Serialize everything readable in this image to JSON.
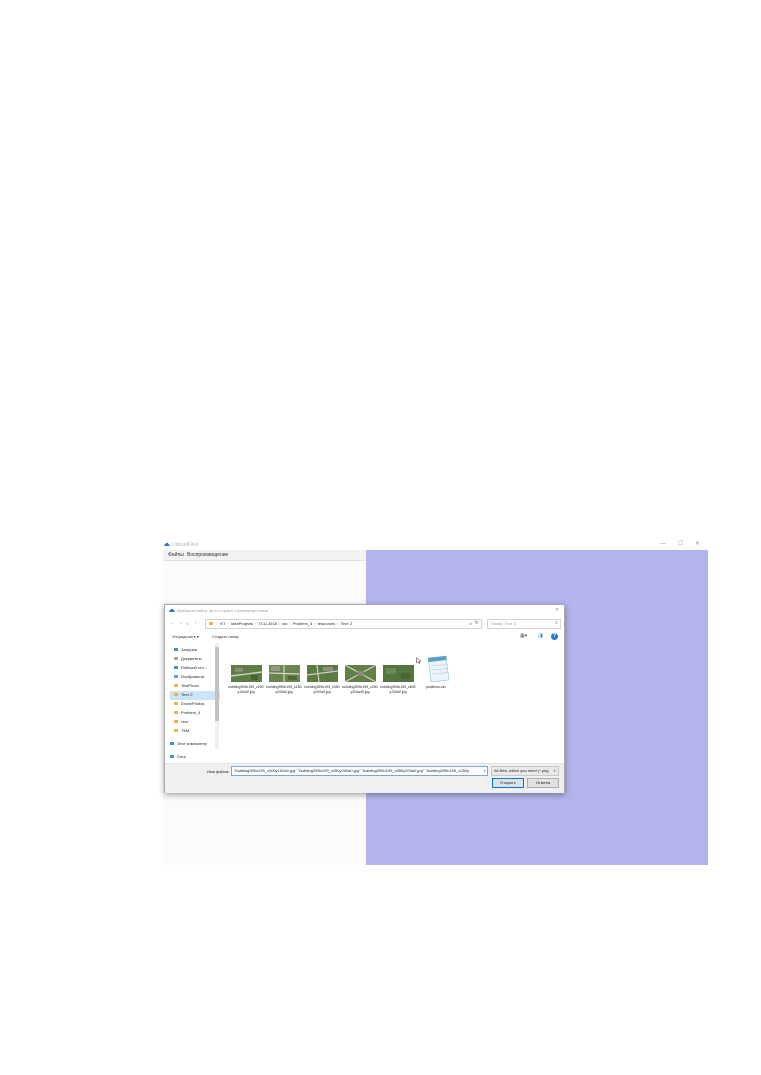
{
  "app": {
    "title": "UploadFiles",
    "menu": [
      "Файлы",
      "Воспроизведение"
    ],
    "window_controls": [
      "—",
      "☐",
      "✕"
    ],
    "colors": {
      "canvas": "#b3b4ec",
      "accent": "#0078d7"
    }
  },
  "dialog": {
    "title": "Выберите набор фото и файл с перемещениями",
    "close": "✕",
    "nav_buttons": [
      "←",
      "→",
      "∨",
      "↑"
    ],
    "breadcrumbs": [
      "KT",
      "IdeaProjects",
      "TCU-2018",
      "src",
      "Problem_3",
      "resources",
      "Тест 2"
    ],
    "search_placeholder": "Поиск: Тест 2",
    "toolbar": {
      "organize": "Упорядочить ▾",
      "new_folder": "Создать папку"
    },
    "nav_items": [
      {
        "label": "Загрузки",
        "icon": "download-icon",
        "pinned": true
      },
      {
        "label": "Документы",
        "icon": "documents-icon",
        "pinned": true
      },
      {
        "label": "Рабочий сто...",
        "icon": "desktop-icon",
        "pinned": true
      },
      {
        "label": "Изображени",
        "icon": "pictures-icon",
        "pinned": true
      },
      {
        "label": "TestPhoto",
        "icon": "folder-icon",
        "pinned": true
      },
      {
        "label": "Тест 2",
        "icon": "folder-icon",
        "pinned": false,
        "selected": true
      },
      {
        "label": "DronePhotos",
        "icon": "folder-icon",
        "pinned": false
      },
      {
        "label": "Problem_4",
        "icon": "folder-icon",
        "pinned": false
      },
      {
        "label": "тест",
        "icon": "folder-icon",
        "pinned": false
      },
      {
        "label": "ТКМ",
        "icon": "folder-icon",
        "pinned": false
      },
      {
        "label": "Этот компьютер",
        "icon": "computer-icon",
        "pinned": false
      },
      {
        "label": "Сеть",
        "icon": "network-icon",
        "pinned": false
      }
    ],
    "files": [
      {
        "name": "building399n199_x200y100a0.jpg",
        "type": "image"
      },
      {
        "name": "building399n199_x250y200a0.jpg",
        "type": "image"
      },
      {
        "name": "building399n199_x350y200a0.jpg",
        "type": "image"
      },
      {
        "name": "building399n199_x250y200a45.jpg",
        "type": "image"
      },
      {
        "name": "building399n199_x800y700a0.jpg",
        "type": "image"
      },
      {
        "name": "positions.csv",
        "type": "notepad"
      }
    ],
    "filename_label": "Имя файла:",
    "filename_value": "\"building399n199_x200y100a0.jpg\" \"building399n199_x250y200a0.jpg\" \"building399n199_x350y200a0.jpg\" \"building399n199_x250y",
    "filetype": "All files, which you need (*.png",
    "buttons": {
      "open": "Открыть",
      "cancel": "Отмена"
    }
  }
}
